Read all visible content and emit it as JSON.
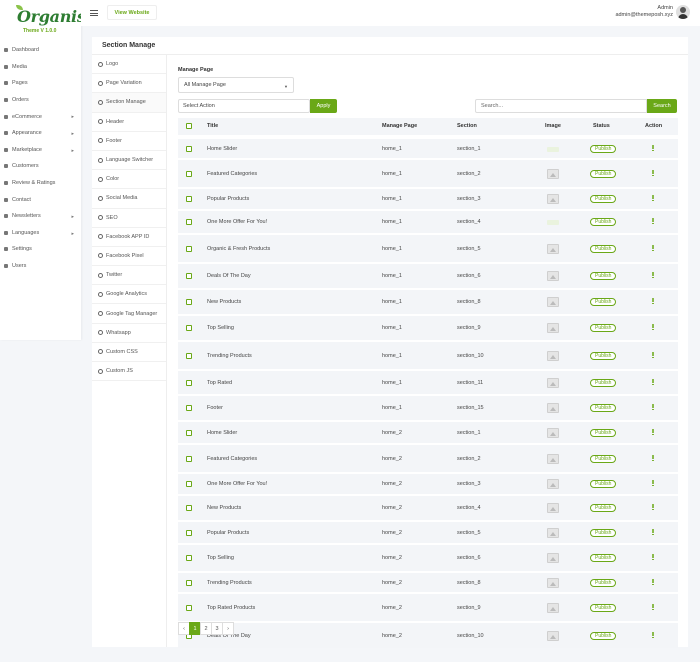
{
  "sidebar": {
    "logo": "Organis",
    "theme_version": "Theme V 1.0.0",
    "items": [
      {
        "label": "Dashboard",
        "icon": "speedometer-icon",
        "chevron": false
      },
      {
        "label": "Media",
        "icon": "image-icon",
        "chevron": false
      },
      {
        "label": "Pages",
        "icon": "page-icon",
        "chevron": false
      },
      {
        "label": "Orders",
        "icon": "rocket-icon",
        "chevron": false
      },
      {
        "label": "eCommerce",
        "icon": "cart-icon",
        "chevron": true
      },
      {
        "label": "Appearance",
        "icon": "brush-icon",
        "chevron": true
      },
      {
        "label": "Marketplace",
        "icon": "send-icon",
        "chevron": true
      },
      {
        "label": "Customers",
        "icon": "users-icon",
        "chevron": false
      },
      {
        "label": "Review & Ratings",
        "icon": "star-icon",
        "chevron": false
      },
      {
        "label": "Contact",
        "icon": "envelope-icon",
        "chevron": false
      },
      {
        "label": "Newsletters",
        "icon": "mail-icon",
        "chevron": true
      },
      {
        "label": "Languages",
        "icon": "globe-icon",
        "chevron": true
      },
      {
        "label": "Settings",
        "icon": "gear-icon",
        "chevron": false
      },
      {
        "label": "Users",
        "icon": "user-icon",
        "chevron": false
      }
    ]
  },
  "header": {
    "view_website": "View Website",
    "admin_name": "Admin",
    "admin_email": "admin@themeposh.xyz"
  },
  "panel": {
    "title": "Section Manage",
    "sub_items": [
      "Logo",
      "Page Variation",
      "Section Manage",
      "Header",
      "Footer",
      "Language Switcher",
      "Color",
      "Social Media",
      "SEO",
      "Facebook APP ID",
      "Facebook Pixel",
      "Twitter",
      "Google Analytics",
      "Google Tag Manager",
      "Whatsapp",
      "Custom CSS",
      "Custom JS"
    ],
    "manage_page_label": "Manage Page",
    "manage_page_value": "All Manage Page",
    "select_action": "Select Action",
    "apply": "Apply",
    "search_placeholder": "Search...",
    "search": "Search"
  },
  "table": {
    "headers": {
      "title": "Title",
      "page": "Manage Page",
      "section": "Section",
      "image": "Image",
      "status": "Status",
      "action": "Action"
    },
    "rows": [
      {
        "title": "Home Slider",
        "page": "home_1",
        "section": "section_1",
        "image": "blank",
        "status": "Publish"
      },
      {
        "title": "Featured Categories",
        "page": "home_1",
        "section": "section_2",
        "image": "icon",
        "status": "Publish"
      },
      {
        "title": "Popular Products",
        "page": "home_1",
        "section": "section_3",
        "image": "icon",
        "status": "Publish"
      },
      {
        "title": "One More Offer For You!",
        "page": "home_1",
        "section": "section_4",
        "image": "blank",
        "status": "Publish"
      },
      {
        "title": "Organic & Fresh Products",
        "page": "home_1",
        "section": "section_5",
        "image": "icon",
        "status": "Publish"
      },
      {
        "title": "Deals Of The Day",
        "page": "home_1",
        "section": "section_6",
        "image": "icon",
        "status": "Publish"
      },
      {
        "title": "New Products",
        "page": "home_1",
        "section": "section_8",
        "image": "icon",
        "status": "Publish"
      },
      {
        "title": "Top Selling",
        "page": "home_1",
        "section": "section_9",
        "image": "icon",
        "status": "Publish"
      },
      {
        "title": "Trending Products",
        "page": "home_1",
        "section": "section_10",
        "image": "icon",
        "status": "Publish"
      },
      {
        "title": "Top Rated",
        "page": "home_1",
        "section": "section_11",
        "image": "icon",
        "status": "Publish"
      },
      {
        "title": "Footer",
        "page": "home_1",
        "section": "section_15",
        "image": "icon",
        "status": "Publish"
      },
      {
        "title": "Home Slider",
        "page": "home_2",
        "section": "section_1",
        "image": "icon",
        "status": "Publish"
      },
      {
        "title": "Featured Categories",
        "page": "home_2",
        "section": "section_2",
        "image": "icon",
        "status": "Publish"
      },
      {
        "title": "One More Offer For You!",
        "page": "home_2",
        "section": "section_3",
        "image": "icon",
        "status": "Publish"
      },
      {
        "title": "New Products",
        "page": "home_2",
        "section": "section_4",
        "image": "icon",
        "status": "Publish"
      },
      {
        "title": "Popular Products",
        "page": "home_2",
        "section": "section_5",
        "image": "icon",
        "status": "Publish"
      },
      {
        "title": "Top Selling",
        "page": "home_2",
        "section": "section_6",
        "image": "icon",
        "status": "Publish"
      },
      {
        "title": "Trending Products",
        "page": "home_2",
        "section": "section_8",
        "image": "icon",
        "status": "Publish"
      },
      {
        "title": "Top Rated Products",
        "page": "home_2",
        "section": "section_9",
        "image": "icon",
        "status": "Publish"
      },
      {
        "title": "Deals Of The Day",
        "page": "home_2",
        "section": "section_10",
        "image": "icon",
        "status": "Publish"
      }
    ]
  },
  "pagination": {
    "prev": "‹",
    "pages": [
      "1",
      "2",
      "3"
    ],
    "next": "›",
    "active": "1"
  },
  "colors": {
    "accent": "#6aa817",
    "logo_green": "#2e7d32",
    "row_bg": "#f3f5f8"
  }
}
